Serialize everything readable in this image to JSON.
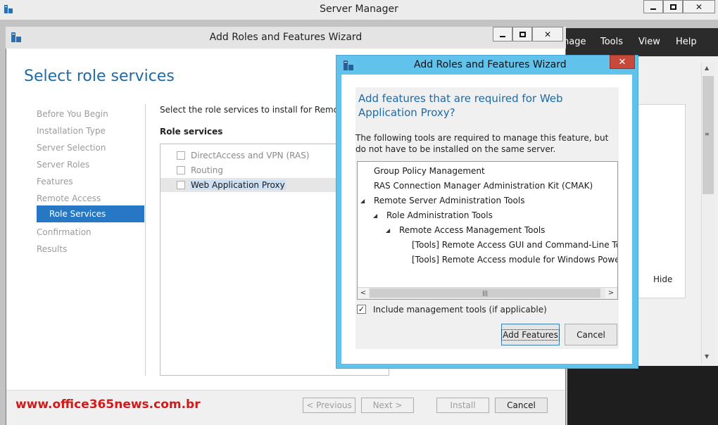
{
  "server_manager": {
    "title": "Server Manager",
    "menu": [
      "nage",
      "Tools",
      "View",
      "Help"
    ],
    "hide_label": "Hide"
  },
  "wizard": {
    "title": "Add Roles and Features Wizard",
    "heading": "Select role services",
    "nav": [
      {
        "label": "Before You Begin",
        "active": false
      },
      {
        "label": "Installation Type",
        "active": false
      },
      {
        "label": "Server Selection",
        "active": false
      },
      {
        "label": "Server Roles",
        "active": false
      },
      {
        "label": "Features",
        "active": false
      },
      {
        "label": "Remote Access",
        "active": false
      },
      {
        "label": "Role Services",
        "active": true
      },
      {
        "label": "Confirmation",
        "active": false
      },
      {
        "label": "Results",
        "active": false
      }
    ],
    "intro": "Select the role services to install for Remote Access",
    "role_services_header": "Role services",
    "roles": [
      {
        "label": "DirectAccess and VPN (RAS)",
        "checked": false
      },
      {
        "label": "Routing",
        "checked": false
      },
      {
        "label": "Web Application Proxy",
        "checked": false
      }
    ],
    "buttons": {
      "previous": "< Previous",
      "next": "Next >",
      "install": "Install",
      "cancel": "Cancel"
    }
  },
  "watermark": "www.office365news.com.br",
  "dialog": {
    "title": "Add Roles and Features Wizard",
    "heading": "Add features that are required for Web Application Proxy?",
    "description": "The following tools are required to manage this feature, but do not have to be installed on the same server.",
    "tree": [
      {
        "label": "Group Policy Management",
        "level": 0,
        "expanded": false
      },
      {
        "label": "RAS Connection Manager Administration Kit (CMAK)",
        "level": 0,
        "expanded": false
      },
      {
        "label": "Remote Server Administration Tools",
        "level": 0,
        "expanded": true
      },
      {
        "label": "Role Administration Tools",
        "level": 1,
        "expanded": true
      },
      {
        "label": "Remote Access Management Tools",
        "level": 2,
        "expanded": true
      },
      {
        "label": "[Tools] Remote Access GUI and Command-Line Tools",
        "level": 3,
        "expanded": false
      },
      {
        "label": "[Tools] Remote Access module for Windows PowerShell",
        "level": 3,
        "expanded": false
      }
    ],
    "include_tools_label": "Include management tools (if applicable)",
    "include_tools_checked": true,
    "add_features_label": "Add Features",
    "cancel_label": "Cancel"
  }
}
